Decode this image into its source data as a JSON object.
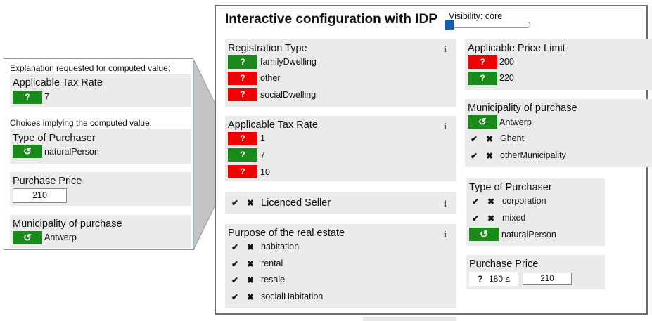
{
  "header": {
    "title": "Interactive configuration with IDP",
    "visibility_label": "Visibility: core"
  },
  "icons": {
    "unknown": "?",
    "reset": "↺",
    "info": "i",
    "check": "✔",
    "cross": "✖"
  },
  "colors": {
    "red": "#f00000",
    "green": "#1a8a1a",
    "panel": "#ebebeb"
  },
  "registration_type": {
    "title": "Registration Type",
    "options": [
      "familyDwelling",
      "other",
      "socialDwelling"
    ]
  },
  "tax_rate": {
    "title": "Applicable Tax Rate",
    "options": [
      "1",
      "7",
      "10"
    ]
  },
  "licenced_seller": {
    "title": "Licenced Seller"
  },
  "purpose": {
    "title": "Purpose of the real estate",
    "options": [
      "habitation",
      "rental",
      "resale",
      "socialHabitation"
    ]
  },
  "price_limit": {
    "title": "Applicable Price Limit",
    "options": [
      "200",
      "220"
    ]
  },
  "municipality": {
    "title": "Municipality of purchase",
    "options": [
      "Antwerp",
      "Ghent",
      "otherMunicipality"
    ]
  },
  "purchaser": {
    "title": "Type of Purchaser",
    "options": [
      "corporation",
      "mixed",
      "naturalPerson"
    ]
  },
  "purchase_price": {
    "title": "Purchase Price",
    "bound": "180 ≤",
    "value": "210"
  },
  "explanation": {
    "header": "Explanation requested for computed value:",
    "computed_title": "Applicable Tax Rate",
    "computed_value": "7",
    "choices_header": "Choices implying the computed value:",
    "purchaser_title": "Type of Purchaser",
    "purchaser_value": "naturalPerson",
    "price_title": "Purchase Price",
    "price_value": "210",
    "municipality_title": "Municipality of purchase",
    "municipality_value": "Antwerp"
  }
}
